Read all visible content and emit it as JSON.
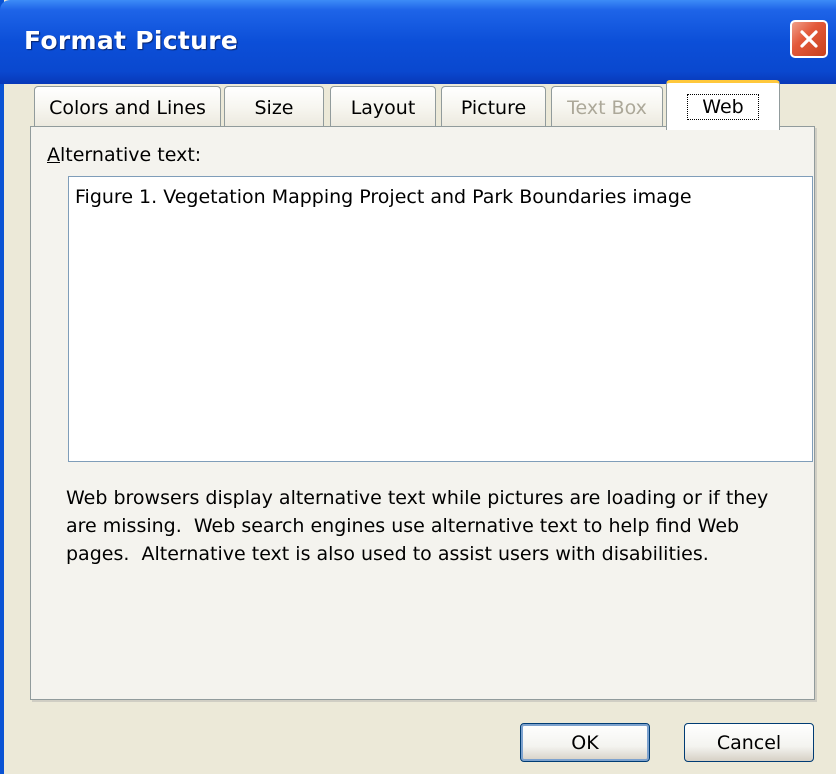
{
  "window": {
    "title": "Format Picture"
  },
  "tabs": [
    {
      "label": "Colors and Lines",
      "state": "normal"
    },
    {
      "label": "Size",
      "state": "normal"
    },
    {
      "label": "Layout",
      "state": "normal"
    },
    {
      "label": "Picture",
      "state": "normal"
    },
    {
      "label": "Text Box",
      "state": "disabled"
    },
    {
      "label": "Web",
      "state": "active"
    }
  ],
  "web_tab": {
    "alt_label_mnemonic": "A",
    "alt_label_rest": "lternative text:",
    "alt_text_value": "Figure 1. Vegetation Mapping Project and Park Boundaries image",
    "help_text": "Web browsers display alternative text while pictures are loading or if they are missing.  Web search engines use alternative text to help find Web pages.  Alternative text is also used to assist users with disabilities."
  },
  "buttons": {
    "ok": "OK",
    "cancel": "Cancel"
  },
  "colors": {
    "titlebar": "#0A48CF",
    "dialog_bg": "#ECE9D8",
    "close_button": "#E3593A",
    "active_tab_highlight": "#FFC83C"
  },
  "icons": {
    "close": "close-icon"
  }
}
